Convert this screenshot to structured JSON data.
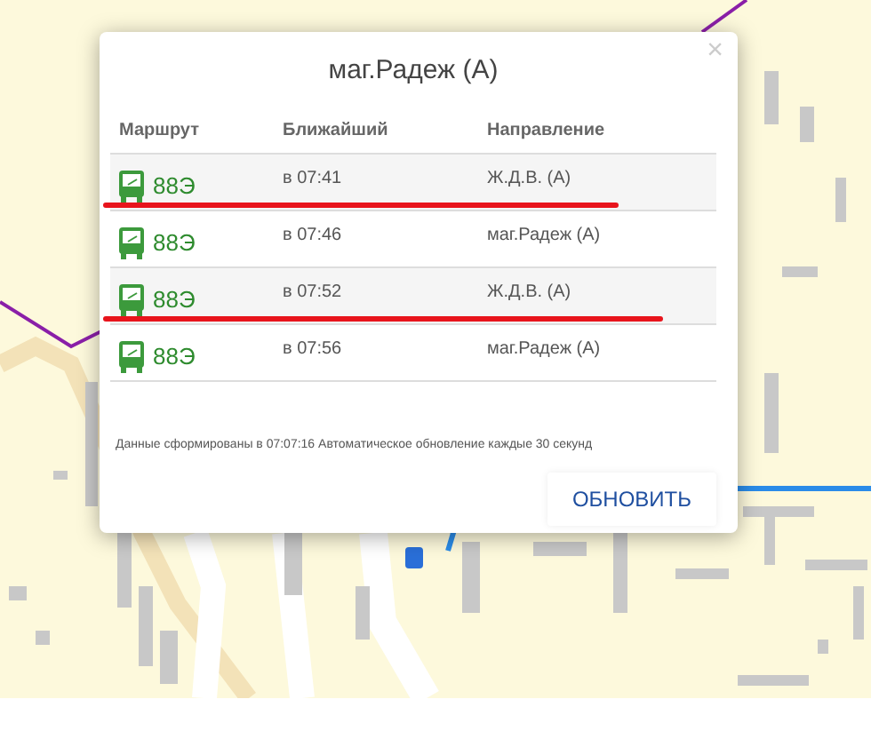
{
  "popup": {
    "title": "маг.Радеж (А)",
    "close": "×",
    "columns": [
      "Маршрут",
      "Ближайший",
      "Направление"
    ],
    "rows": [
      {
        "route": "88Э",
        "time": "в 07:41",
        "direction": "Ж.Д.В. (А)",
        "underlined": true
      },
      {
        "route": "88Э",
        "time": "в 07:46",
        "direction": "маг.Радеж (А)",
        "underlined": false
      },
      {
        "route": "88Э",
        "time": "в 07:52",
        "direction": "Ж.Д.В. (А)",
        "underlined": true
      },
      {
        "route": "88Э",
        "time": "в 07:56",
        "direction": "маг.Радеж (А)",
        "underlined": false
      }
    ],
    "note": "Данные сформированы в 07:07:16 Автоматическое обновление каждые 30 секунд",
    "button": "ОБНОВИТЬ"
  }
}
